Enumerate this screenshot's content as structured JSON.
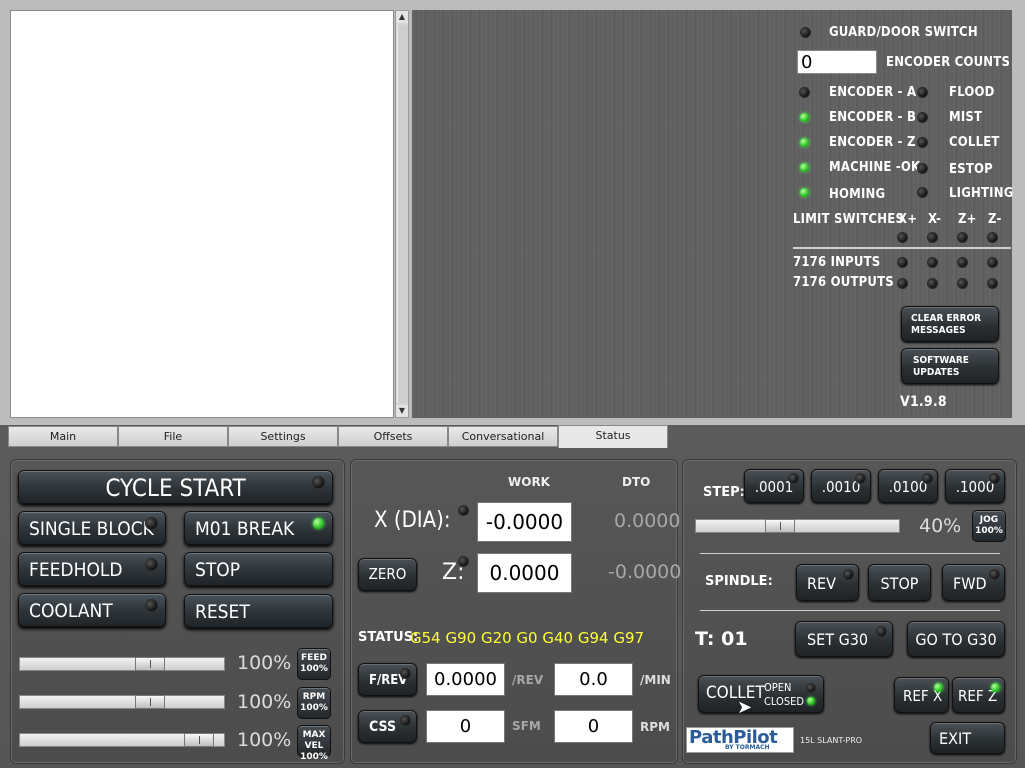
{
  "status_panel": {
    "guard_door_label": "GUARD/DOOR SWITCH",
    "encoder_counts_value": "0",
    "encoder_counts_label": "ENCODER COUNTS",
    "left_signals": [
      {
        "label": "ENCODER - A",
        "on": false
      },
      {
        "label": "ENCODER - B",
        "on": true
      },
      {
        "label": "ENCODER - Z",
        "on": true
      },
      {
        "label": "MACHINE -OK",
        "on": true
      },
      {
        "label": "HOMING",
        "on": true
      }
    ],
    "right_signals": [
      {
        "label": "FLOOD",
        "on": false
      },
      {
        "label": "MIST",
        "on": false
      },
      {
        "label": "COLLET",
        "on": false
      },
      {
        "label": "ESTOP",
        "on": false
      },
      {
        "label": "LIGHTING",
        "on": false
      }
    ],
    "limit_switches_label": "LIMIT SWITCHES",
    "limit_axes": [
      "X+",
      "X-",
      "Z+",
      "Z-"
    ],
    "inputs_label": "7176 INPUTS",
    "outputs_label": "7176 OUTPUTS",
    "clear_error_label_1": "CLEAR ERROR",
    "clear_error_label_2": "MESSAGES",
    "software_updates_label_1": "SOFTWARE",
    "software_updates_label_2": "UPDATES",
    "version": "V1.9.8"
  },
  "tabs": [
    {
      "label": "Main",
      "active": false
    },
    {
      "label": "File",
      "active": false
    },
    {
      "label": "Settings",
      "active": false
    },
    {
      "label": "Offsets",
      "active": false
    },
    {
      "label": "Conversational",
      "active": false
    },
    {
      "label": "Status",
      "active": true
    }
  ],
  "control": {
    "cycle_start": "CYCLE START",
    "single_block": "SINGLE BLOCK",
    "m01_break": "M01 BREAK",
    "feedhold": "FEEDHOLD",
    "stop": "STOP",
    "coolant": "COOLANT",
    "reset": "RESET",
    "feed_pct": "100%",
    "rpm_pct": "100%",
    "maxvel_pct": "100%",
    "feed_btn_1": "FEED",
    "feed_btn_2": "100%",
    "rpm_btn_1": "RPM",
    "rpm_btn_2": "100%",
    "maxvel_btn_1": "MAX VEL",
    "maxvel_btn_2": "100%",
    "feed_slider_level": 0.66,
    "rpm_slider_level": 0.66,
    "maxvel_slider_level": 0.94
  },
  "dro": {
    "work_header": "WORK",
    "dto_header": "DTO",
    "x_label": "X (DIA):",
    "x_work": "-0.0000",
    "x_dto": "0.0000",
    "z_label": "Z:",
    "z_work": "0.0000",
    "z_dto": "-0.0000",
    "zero_label": "ZERO",
    "status_label": "STATUS:",
    "status_codes": "G54 G90 G20 G0 G40 G94 G97",
    "frev_label": "F/REV",
    "frev_value": "0.0000",
    "frev_unit": "/REV",
    "fmin_value": "0.0",
    "fmin_unit": "/MIN",
    "css_label": "CSS",
    "sfm_value": "0",
    "sfm_unit": "SFM",
    "rpm_value": "0",
    "rpm_unit": "RPM",
    "highlight_color": "#ffff33"
  },
  "jog": {
    "step_label": "STEP:",
    "steps": [
      ".0001",
      ".0010",
      ".0100",
      ".1000"
    ],
    "jog_pct": "40%",
    "jog_level": 0.4,
    "jog_btn_1": "JOG",
    "jog_btn_2": "100%",
    "spindle_label": "SPINDLE:",
    "rev_label": "REV",
    "stop_label": "STOP",
    "fwd_label": "FWD",
    "tool_label": "T: 01",
    "set_g30": "SET G30",
    "go_to_g30": "GO TO G30",
    "collet_label": "COLLET",
    "collet_open": "OPEN",
    "collet_closed": "CLOSED",
    "ref_x": "REF X",
    "ref_z": "REF Z",
    "logo_text": "PathPilot",
    "logo_sub": "BY TORMACH",
    "machine_model": "15L SLANT-PRO",
    "exit_label": "EXIT"
  }
}
